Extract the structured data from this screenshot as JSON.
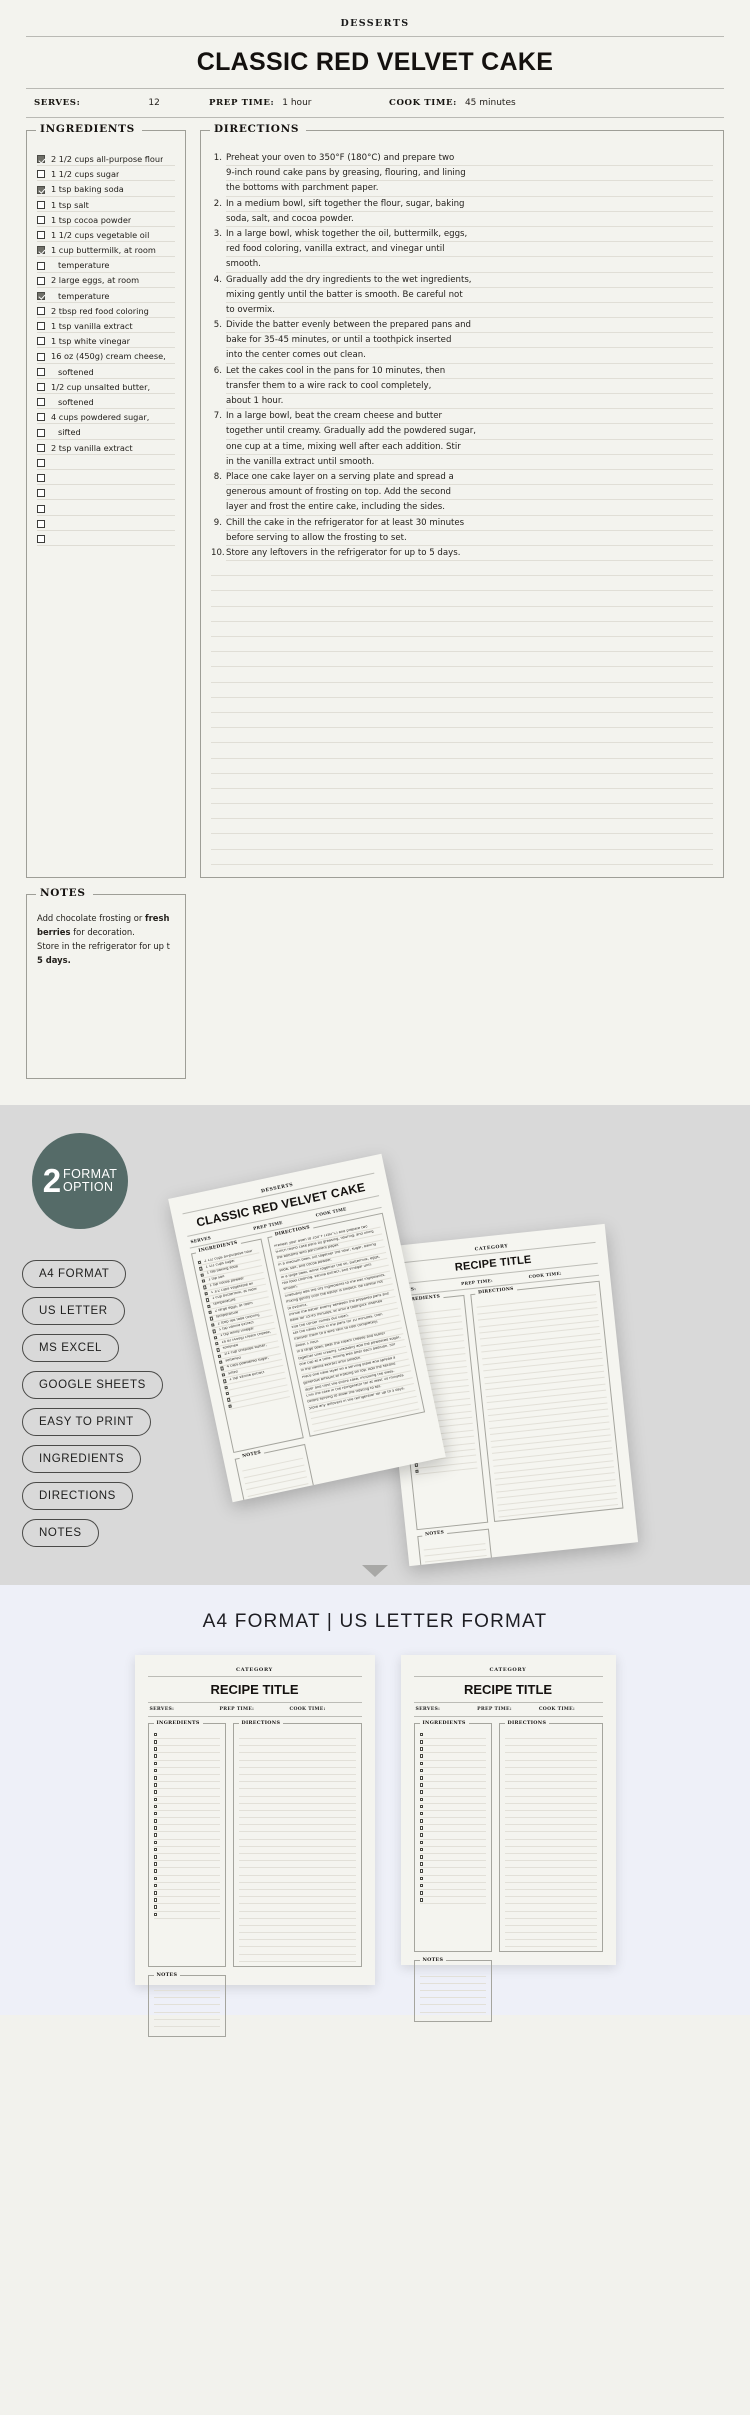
{
  "recipe": {
    "category": "DESSERTS",
    "title": "CLASSIC RED VELVET CAKE",
    "meta": {
      "serves_label": "SERVES:",
      "serves_value": "12",
      "prep_label": "PREP TIME:",
      "prep_value": "1 hour",
      "cook_label": "COOK TIME:",
      "cook_value": "45 minutes"
    },
    "ingredients_legend": "INGREDIENTS",
    "directions_legend": "DIRECTIONS",
    "notes_legend": "NOTES",
    "ingredients": [
      {
        "checked": true,
        "text": "2 1/2 cups all-purpose flour",
        "indent": false
      },
      {
        "checked": false,
        "text": "1 1/2 cups sugar",
        "indent": false
      },
      {
        "checked": true,
        "text": "1 tsp baking soda",
        "indent": false
      },
      {
        "checked": false,
        "text": "1 tsp salt",
        "indent": false
      },
      {
        "checked": false,
        "text": "1 tsp cocoa powder",
        "indent": false
      },
      {
        "checked": false,
        "text": "1 1/2 cups vegetable oil",
        "indent": false
      },
      {
        "checked": true,
        "text": "1 cup buttermilk, at room",
        "indent": false
      },
      {
        "checked": false,
        "text": "temperature",
        "indent": true
      },
      {
        "checked": false,
        "text": "2 large eggs, at room",
        "indent": false
      },
      {
        "checked": true,
        "text": "temperature",
        "indent": true
      },
      {
        "checked": false,
        "text": "2 tbsp red food coloring",
        "indent": false
      },
      {
        "checked": false,
        "text": "1 tsp vanilla extract",
        "indent": false
      },
      {
        "checked": false,
        "text": "1 tsp white vinegar",
        "indent": false
      },
      {
        "checked": false,
        "text": "16 oz (450g) cream cheese,",
        "indent": false
      },
      {
        "checked": false,
        "text": "softened",
        "indent": true
      },
      {
        "checked": false,
        "text": "1/2 cup unsalted butter,",
        "indent": false
      },
      {
        "checked": false,
        "text": "softened",
        "indent": true
      },
      {
        "checked": false,
        "text": "4 cups powdered sugar,",
        "indent": false
      },
      {
        "checked": false,
        "text": "sifted",
        "indent": true
      },
      {
        "checked": false,
        "text": "2 tsp vanilla extract",
        "indent": false
      },
      {
        "checked": false,
        "text": "",
        "indent": false
      },
      {
        "checked": false,
        "text": "",
        "indent": false
      },
      {
        "checked": false,
        "text": "",
        "indent": false
      },
      {
        "checked": false,
        "text": "",
        "indent": false
      },
      {
        "checked": false,
        "text": "",
        "indent": false
      },
      {
        "checked": false,
        "text": "",
        "indent": false
      }
    ],
    "directions": [
      {
        "num": "1.",
        "lines": [
          "Preheat your oven to 350°F (180°C) and prepare two",
          "9-inch round cake pans by greasing, flouring, and lining",
          "the bottoms with parchment paper."
        ]
      },
      {
        "num": "2.",
        "lines": [
          "In a medium bowl, sift together the flour, sugar, baking",
          "soda, salt, and cocoa powder."
        ]
      },
      {
        "num": "3.",
        "lines": [
          "In a large bowl, whisk together the oil, buttermilk, eggs,",
          "red food coloring, vanilla extract, and vinegar until",
          "smooth."
        ]
      },
      {
        "num": "4.",
        "lines": [
          "Gradually add the dry ingredients to the wet ingredients,",
          "mixing gently until the batter is smooth. Be careful not",
          "to overmix."
        ]
      },
      {
        "num": "5.",
        "lines": [
          "Divide the batter evenly between the prepared pans and",
          "bake for 35-45 minutes, or until a toothpick inserted",
          "into the center comes out clean."
        ]
      },
      {
        "num": "6.",
        "lines": [
          "Let the cakes cool in the pans for 10 minutes, then",
          "transfer them to a wire rack to cool completely,",
          "about 1 hour."
        ]
      },
      {
        "num": "7.",
        "lines": [
          "In a large bowl, beat the cream cheese and butter",
          "together until creamy. Gradually add the powdered sugar,",
          "one cup at a time, mixing well after each addition. Stir",
          "in the vanilla extract until smooth."
        ]
      },
      {
        "num": "8.",
        "lines": [
          "Place one cake layer on a serving plate and spread a",
          "generous amount of frosting on top. Add the second",
          "layer and frost the entire cake, including the sides."
        ]
      },
      {
        "num": "9.",
        "lines": [
          "Chill the cake in the refrigerator for at least 30 minutes",
          "before serving to allow the frosting to set."
        ]
      },
      {
        "num": "10.",
        "lines": [
          "Store any leftovers in the refrigerator for up to 5 days."
        ]
      }
    ],
    "directions_blank_lines": 20,
    "notes": {
      "line1_a": "Add chocolate frosting or ",
      "line1_b": "fresh",
      "line2_b": "berries",
      "line2_a": " for decoration.",
      "line3": "Store in the refrigerator for up t",
      "line4_b": "5 days."
    }
  },
  "format_section": {
    "badge": {
      "number": "2",
      "line1": "FORMAT",
      "line2": "OPTION",
      "color": "#556b68"
    },
    "pills": [
      "A4 FORMAT",
      "US LETTER",
      "MS EXCEL",
      "GOOGLE SHEETS",
      "EASY TO PRINT",
      "INGREDIENTS",
      "DIRECTIONS",
      "NOTES"
    ],
    "mock_front": {
      "category": "DESSERTS",
      "title": "CLASSIC RED VELVET CAKE",
      "serves_label": "SERVES",
      "prep_label": "PREP TIME",
      "cook_label": "COOK TIME",
      "ingredients_legend": "INGREDIENTS",
      "directions_legend": "DIRECTIONS",
      "notes_legend": "NOTES"
    },
    "mock_back": {
      "category": "CATEGORY",
      "title": "RECIPE TITLE",
      "serves_label": "SERVES:",
      "prep_label": "PREP TIME:",
      "cook_label": "COOK TIME:",
      "ingredients_legend": "INGREDIENTS",
      "directions_legend": "DIRECTIONS",
      "notes_legend": "NOTES"
    }
  },
  "footer": {
    "heading": "A4 FORMAT | US LETTER FORMAT",
    "pages": [
      {
        "category": "CATEGORY",
        "title": "RECIPE TITLE",
        "serves_label": "SERVES:",
        "prep_label": "PREP TIME:",
        "cook_label": "COOK TIME:",
        "ingredients_legend": "INGREDIENTS",
        "directions_legend": "DIRECTIONS",
        "notes_legend": "NOTES"
      },
      {
        "category": "CATEGORY",
        "title": "RECIPE TITLE",
        "serves_label": "SERVES:",
        "prep_label": "PREP TIME:",
        "cook_label": "COOK TIME:",
        "ingredients_legend": "INGREDIENTS",
        "directions_legend": "DIRECTIONS",
        "notes_legend": "NOTES"
      }
    ]
  }
}
